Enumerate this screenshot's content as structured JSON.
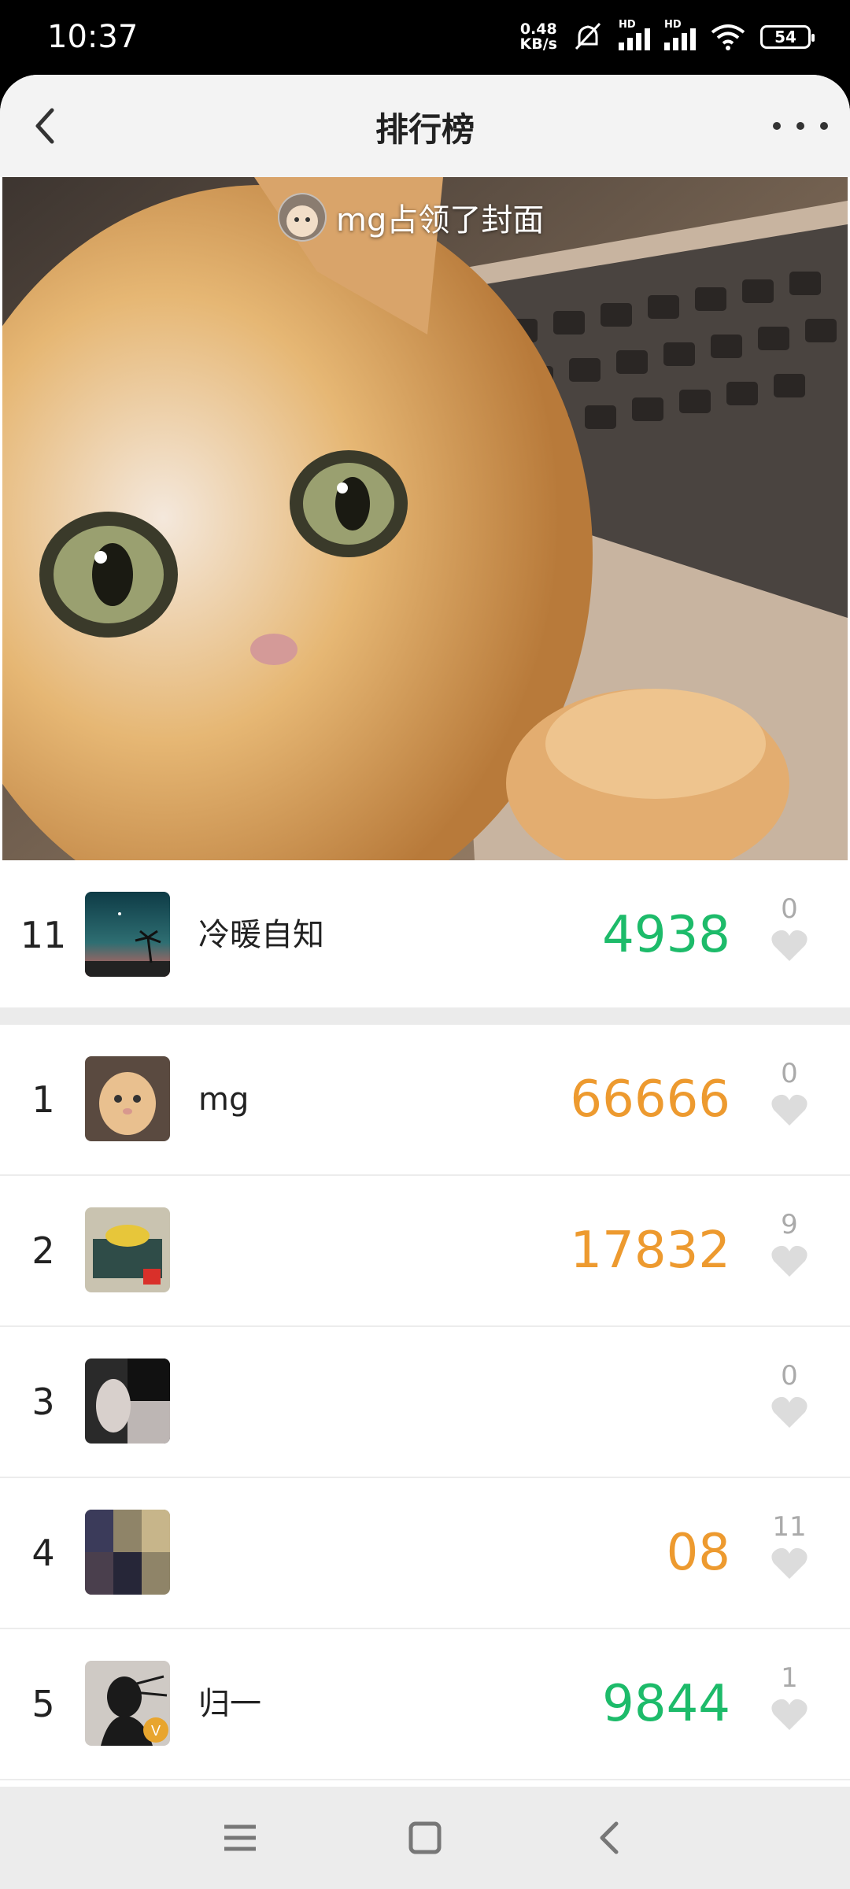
{
  "status_bar": {
    "time": "10:37",
    "net_speed_value": "0.48",
    "net_speed_unit": "KB/s",
    "hd_label": "HD",
    "battery": "54"
  },
  "topbar": {
    "title": "排行榜"
  },
  "cover": {
    "caption": "mg占领了封面"
  },
  "my_entry": {
    "rank": "11",
    "name": "冷暖自知",
    "score": "4938",
    "likes": "0"
  },
  "ranking": [
    {
      "rank": "1",
      "name": "mg",
      "score": "66666",
      "likes": "0",
      "score_color": "#ed9a2f"
    },
    {
      "rank": "2",
      "name": "",
      "score": "17832",
      "likes": "9",
      "score_color": "#ed9a2f"
    },
    {
      "rank": "3",
      "name": "",
      "score": "",
      "likes": "0",
      "score_color": "#ed9a2f"
    },
    {
      "rank": "4",
      "name": "",
      "score": "08",
      "likes": "11",
      "score_color": "#ed9a2f"
    },
    {
      "rank": "5",
      "name": "归一",
      "score": "9844",
      "likes": "1",
      "score_color": "#1dbb6a"
    }
  ],
  "icons": {
    "back": "chevron-left-icon",
    "more": "more-dots-icon",
    "like": "heart-icon",
    "nav_menu": "menu-icon",
    "nav_home": "home-square-icon",
    "nav_back": "back-triangle-icon"
  },
  "colors": {
    "green_score": "#1dbb6a",
    "orange_score": "#ed9a2f",
    "heart_gray": "#dcdcdc"
  }
}
